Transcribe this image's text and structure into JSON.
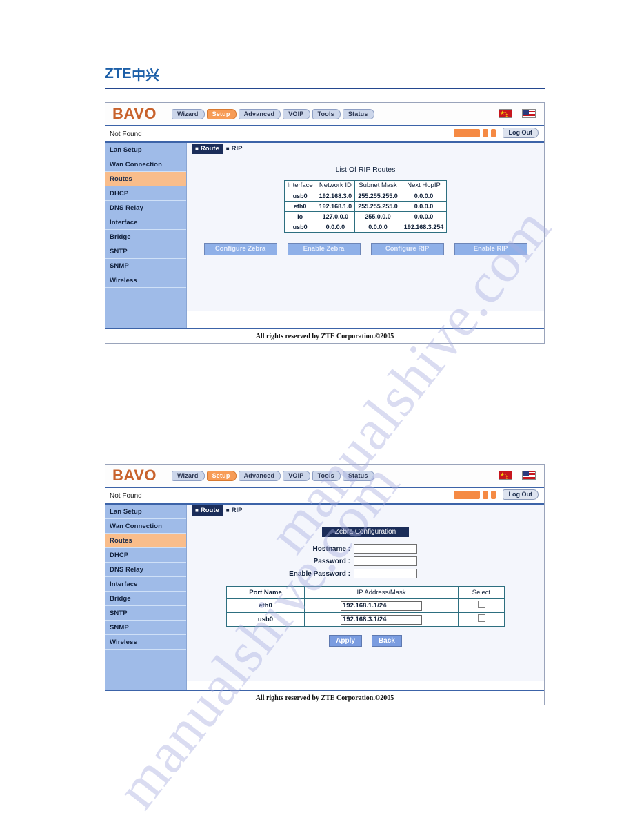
{
  "document": {
    "brand_logo": "ZTE",
    "brand_logo_cn": "中兴",
    "watermark": "manualshive.com"
  },
  "router_ui": {
    "logo": "BAVO",
    "tabs": [
      {
        "label": "Wizard",
        "active": false
      },
      {
        "label": "Setup",
        "active": true
      },
      {
        "label": "Advanced",
        "active": false
      },
      {
        "label": "VOIP",
        "active": false
      },
      {
        "label": "Tools",
        "active": false
      },
      {
        "label": "Status",
        "active": false
      }
    ],
    "flags": [
      "china-flag",
      "usa-flag"
    ],
    "status_text": "Not Found",
    "logout_label": "Log Out",
    "sidebar": [
      {
        "label": "Lan Setup",
        "active": false
      },
      {
        "label": "Wan Connection",
        "active": false
      },
      {
        "label": "Routes",
        "active": true
      },
      {
        "label": "DHCP",
        "active": false
      },
      {
        "label": "DNS Relay",
        "active": false
      },
      {
        "label": "Interface",
        "active": false
      },
      {
        "label": "Bridge",
        "active": false
      },
      {
        "label": "SNTP",
        "active": false
      },
      {
        "label": "SNMP",
        "active": false
      },
      {
        "label": "Wireless",
        "active": false
      }
    ],
    "subtabs": [
      {
        "label": "Route",
        "active": true
      },
      {
        "label": "RIP",
        "active": false
      }
    ],
    "footer": "All rights reserved by ZTE Corporation.©2005"
  },
  "screen1": {
    "title": "List Of RIP Routes",
    "table": {
      "headers": [
        "Interface",
        "Network ID",
        "Subnet Mask",
        "Next HopIP"
      ],
      "rows": [
        [
          "usb0",
          "192.168.3.0",
          "255.255.255.0",
          "0.0.0.0"
        ],
        [
          "eth0",
          "192.168.1.0",
          "255.255.255.0",
          "0.0.0.0"
        ],
        [
          "lo",
          "127.0.0.0",
          "255.0.0.0",
          "0.0.0.0"
        ],
        [
          "usb0",
          "0.0.0.0",
          "0.0.0.0",
          "192.168.3.254"
        ]
      ]
    },
    "buttons": [
      {
        "label": "Configure Zebra"
      },
      {
        "label": "Enable Zebra"
      },
      {
        "label": "Configure RIP"
      },
      {
        "label": "Enable RIP"
      }
    ]
  },
  "screen2": {
    "title": "Zebra Configuration",
    "form": [
      {
        "label": "Hostname :",
        "value": "",
        "placeholder": ""
      },
      {
        "label": "Password :",
        "value": "",
        "placeholder": ""
      },
      {
        "label": "Enable Password :",
        "value": "",
        "placeholder": ""
      }
    ],
    "table": {
      "headers": [
        "Port Name",
        "IP Address/Mask",
        "Select"
      ],
      "rows": [
        {
          "port": "eth0",
          "ip": "192.168.1.1/24",
          "selected": false
        },
        {
          "port": "usb0",
          "ip": "192.168.3.1/24",
          "selected": false
        }
      ]
    },
    "buttons": [
      {
        "label": "Apply"
      },
      {
        "label": "Back"
      }
    ]
  },
  "colors": {
    "accent_orange": "#f79c56",
    "sidebar_blue": "#9fbbe8",
    "active_item": "#f9bd8b",
    "subtab_navy": "#1b2d59",
    "border_blue": "#3c63a8",
    "button_blue": "#8fb0e8"
  }
}
